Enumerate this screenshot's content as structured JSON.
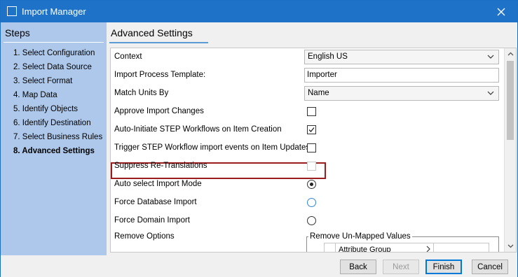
{
  "window": {
    "title": "Import Manager"
  },
  "sidebar": {
    "title": "Steps",
    "steps": [
      {
        "label": "1. Select Configuration"
      },
      {
        "label": "2. Select Data Source"
      },
      {
        "label": "3. Select Format"
      },
      {
        "label": "4. Map Data"
      },
      {
        "label": "5. Identify Objects"
      },
      {
        "label": "6. Identify Destination"
      },
      {
        "label": "7. Select Business Rules"
      },
      {
        "label": "8. Advanced Settings",
        "active": true
      }
    ]
  },
  "main": {
    "title": "Advanced Settings",
    "settings": {
      "context": {
        "label": "Context",
        "value": "English US"
      },
      "import_process_template": {
        "label": "Import Process Template:",
        "value": "Importer"
      },
      "match_units_by": {
        "label": "Match Units By",
        "value": "Name"
      },
      "approve_import_changes": {
        "label": "Approve Import Changes",
        "checked": false
      },
      "auto_initiate": {
        "label": "Auto-Initiate STEP Workflows on Item Creation",
        "checked": true
      },
      "trigger_events": {
        "label": "Trigger STEP Workflow import events on Item Updates",
        "checked": false
      },
      "suppress_retranslations": {
        "label": "Suppress Re-Translations",
        "checked": false,
        "disabled": true
      },
      "auto_select_import_mode": {
        "label": "Auto select Import Mode",
        "selected": true
      },
      "force_database_import": {
        "label": "Force Database Import",
        "selected": false
      },
      "force_domain_import": {
        "label": "Force Domain Import",
        "selected": false
      },
      "remove_options": {
        "label": "Remove Options",
        "group_label": "Remove Un-Mapped Values",
        "table_header": "Attribute Group"
      }
    }
  },
  "footer": {
    "back_label": "Back",
    "next_label": "Next",
    "finish_label": "Finish",
    "cancel_label": "Cancel"
  },
  "colors": {
    "titlebar": "#1e72c8",
    "sidebar": "#adc8ea",
    "highlight_border": "#9b1c1c",
    "title_underline": "#5b9bd5"
  }
}
